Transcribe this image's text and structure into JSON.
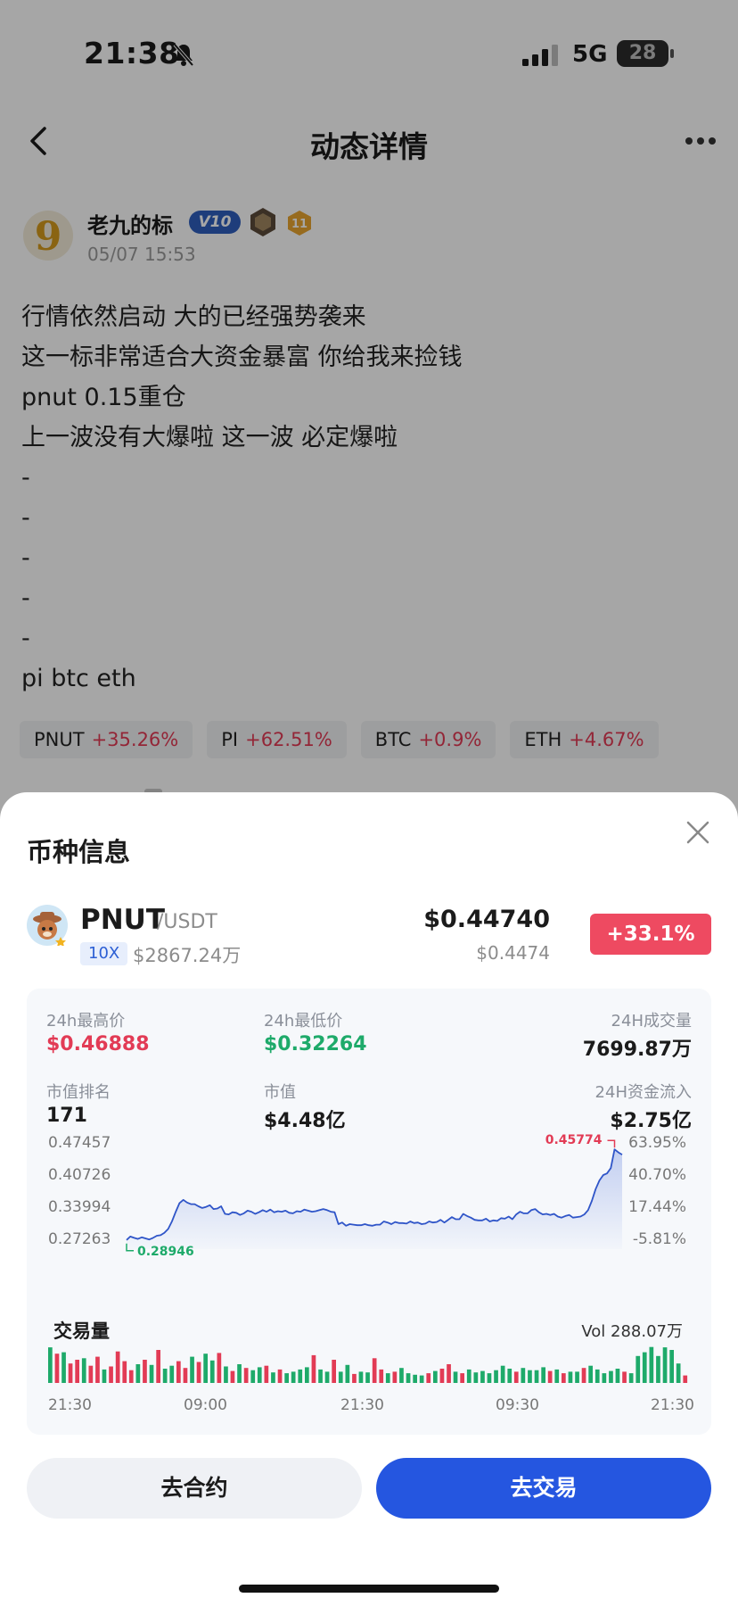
{
  "status_bar": {
    "time": "21:38",
    "network": "5G",
    "battery": "28"
  },
  "header": {
    "title": "动态详情",
    "back_icon": "chevron-left-icon",
    "more_icon": "more-horizontal-icon"
  },
  "post": {
    "author": "老九的标",
    "vip_badge": "V10",
    "level": "11",
    "timestamp": "05/07 15:53",
    "lines": [
      "行情依然启动 大的已经强势袭来",
      "这一标非常适合大资金暴富 你给我来捡钱",
      "pnut 0.15重仓",
      "上一波没有大爆啦 这一波 必定爆啦",
      "-",
      "-",
      "-",
      "-",
      "-",
      "pi btc eth"
    ],
    "tags": [
      {
        "symbol": "PNUT",
        "change": "+35.26%"
      },
      {
        "symbol": "PI",
        "change": "+62.51%"
      },
      {
        "symbol": "BTC",
        "change": "+0.9%"
      },
      {
        "symbol": "ETH",
        "change": "+4.67%"
      }
    ]
  },
  "sheet": {
    "title": "币种信息",
    "coin": {
      "symbol": "PNUT",
      "quote": "/USDT",
      "leverage": "10X",
      "market_cap_short": "$2867.24万",
      "price": "$0.44740",
      "price_sub": "$0.4474",
      "change": "+33.1%"
    },
    "stats": {
      "high_label": "24h最高价",
      "high": "$0.46888",
      "low_label": "24h最低价",
      "low": "$0.32264",
      "vol_label": "24H成交量",
      "vol": "7699.87万",
      "rank_label": "市值排名",
      "rank": "171",
      "mcap_label": "市值",
      "mcap": "$4.48亿",
      "inflow_label": "24H资金流入",
      "inflow": "$2.75亿"
    },
    "volume": {
      "title": "交易量",
      "total": "Vol 288.07万"
    },
    "buttons": {
      "contract": "去合约",
      "trade": "去交易"
    }
  },
  "chart_data": {
    "type": "area",
    "y_ticks": [
      "0.47457",
      "0.40726",
      "0.33994",
      "0.27263"
    ],
    "pct_ticks": [
      "63.95%",
      "40.70%",
      "17.44%",
      "-5.81%"
    ],
    "ylim": [
      0.27263,
      0.47457
    ],
    "x_ticks": [
      "21:30",
      "09:00",
      "21:30",
      "09:30",
      "21:30"
    ],
    "max_label": "0.45774",
    "min_label": "0.28946",
    "price_series": [
      0.2895,
      0.296,
      0.2935,
      0.2915,
      0.2945,
      0.2925,
      0.2905,
      0.2935,
      0.2975,
      0.2985,
      0.303,
      0.31,
      0.324,
      0.342,
      0.358,
      0.364,
      0.359,
      0.356,
      0.356,
      0.352,
      0.349,
      0.351,
      0.354,
      0.347,
      0.348,
      0.352,
      0.338,
      0.337,
      0.341,
      0.34,
      0.336,
      0.339,
      0.344,
      0.342,
      0.338,
      0.341,
      0.345,
      0.342,
      0.346,
      0.341,
      0.343,
      0.342,
      0.344,
      0.34,
      0.339,
      0.343,
      0.342,
      0.346,
      0.344,
      0.342,
      0.343,
      0.345,
      0.347,
      0.345,
      0.342,
      0.341,
      0.319,
      0.322,
      0.316,
      0.319,
      0.318,
      0.317,
      0.317,
      0.319,
      0.317,
      0.316,
      0.318,
      0.318,
      0.324,
      0.322,
      0.319,
      0.323,
      0.321,
      0.321,
      0.32,
      0.324,
      0.321,
      0.322,
      0.319,
      0.32,
      0.324,
      0.322,
      0.323,
      0.327,
      0.322,
      0.327,
      0.332,
      0.328,
      0.328,
      0.338,
      0.334,
      0.331,
      0.327,
      0.326,
      0.326,
      0.329,
      0.324,
      0.326,
      0.325,
      0.33,
      0.329,
      0.333,
      0.328,
      0.337,
      0.342,
      0.339,
      0.339,
      0.345,
      0.347,
      0.341,
      0.337,
      0.338,
      0.336,
      0.338,
      0.333,
      0.331,
      0.334,
      0.336,
      0.331,
      0.332,
      0.333,
      0.337,
      0.345,
      0.362,
      0.384,
      0.4,
      0.41,
      0.413,
      0.423,
      0.4577,
      0.452,
      0.448
    ],
    "volume_series": [
      {
        "v": 0.95,
        "dir": "up"
      },
      {
        "v": 0.78,
        "dir": "down"
      },
      {
        "v": 0.82,
        "dir": "up"
      },
      {
        "v": 0.52,
        "dir": "down"
      },
      {
        "v": 0.62,
        "dir": "down"
      },
      {
        "v": 0.66,
        "dir": "up"
      },
      {
        "v": 0.46,
        "dir": "down"
      },
      {
        "v": 0.7,
        "dir": "down"
      },
      {
        "v": 0.36,
        "dir": "up"
      },
      {
        "v": 0.44,
        "dir": "down"
      },
      {
        "v": 0.84,
        "dir": "down"
      },
      {
        "v": 0.58,
        "dir": "down"
      },
      {
        "v": 0.34,
        "dir": "down"
      },
      {
        "v": 0.5,
        "dir": "up"
      },
      {
        "v": 0.62,
        "dir": "down"
      },
      {
        "v": 0.48,
        "dir": "up"
      },
      {
        "v": 0.88,
        "dir": "down"
      },
      {
        "v": 0.38,
        "dir": "up"
      },
      {
        "v": 0.46,
        "dir": "up"
      },
      {
        "v": 0.58,
        "dir": "down"
      },
      {
        "v": 0.4,
        "dir": "down"
      },
      {
        "v": 0.7,
        "dir": "up"
      },
      {
        "v": 0.56,
        "dir": "down"
      },
      {
        "v": 0.78,
        "dir": "up"
      },
      {
        "v": 0.6,
        "dir": "up"
      },
      {
        "v": 0.8,
        "dir": "down"
      },
      {
        "v": 0.44,
        "dir": "up"
      },
      {
        "v": 0.32,
        "dir": "down"
      },
      {
        "v": 0.5,
        "dir": "up"
      },
      {
        "v": 0.4,
        "dir": "down"
      },
      {
        "v": 0.34,
        "dir": "up"
      },
      {
        "v": 0.42,
        "dir": "up"
      },
      {
        "v": 0.46,
        "dir": "down"
      },
      {
        "v": 0.28,
        "dir": "up"
      },
      {
        "v": 0.36,
        "dir": "down"
      },
      {
        "v": 0.26,
        "dir": "up"
      },
      {
        "v": 0.3,
        "dir": "up"
      },
      {
        "v": 0.36,
        "dir": "up"
      },
      {
        "v": 0.42,
        "dir": "up"
      },
      {
        "v": 0.74,
        "dir": "down"
      },
      {
        "v": 0.36,
        "dir": "up"
      },
      {
        "v": 0.3,
        "dir": "up"
      },
      {
        "v": 0.62,
        "dir": "down"
      },
      {
        "v": 0.3,
        "dir": "up"
      },
      {
        "v": 0.48,
        "dir": "up"
      },
      {
        "v": 0.24,
        "dir": "down"
      },
      {
        "v": 0.3,
        "dir": "up"
      },
      {
        "v": 0.28,
        "dir": "up"
      },
      {
        "v": 0.66,
        "dir": "down"
      },
      {
        "v": 0.36,
        "dir": "down"
      },
      {
        "v": 0.26,
        "dir": "up"
      },
      {
        "v": 0.3,
        "dir": "down"
      },
      {
        "v": 0.4,
        "dir": "up"
      },
      {
        "v": 0.26,
        "dir": "up"
      },
      {
        "v": 0.22,
        "dir": "up"
      },
      {
        "v": 0.2,
        "dir": "up"
      },
      {
        "v": 0.26,
        "dir": "down"
      },
      {
        "v": 0.32,
        "dir": "up"
      },
      {
        "v": 0.38,
        "dir": "down"
      },
      {
        "v": 0.5,
        "dir": "down"
      },
      {
        "v": 0.3,
        "dir": "up"
      },
      {
        "v": 0.26,
        "dir": "down"
      },
      {
        "v": 0.36,
        "dir": "up"
      },
      {
        "v": 0.28,
        "dir": "up"
      },
      {
        "v": 0.32,
        "dir": "up"
      },
      {
        "v": 0.26,
        "dir": "up"
      },
      {
        "v": 0.34,
        "dir": "up"
      },
      {
        "v": 0.46,
        "dir": "up"
      },
      {
        "v": 0.38,
        "dir": "up"
      },
      {
        "v": 0.3,
        "dir": "down"
      },
      {
        "v": 0.4,
        "dir": "up"
      },
      {
        "v": 0.34,
        "dir": "up"
      },
      {
        "v": 0.34,
        "dir": "up"
      },
      {
        "v": 0.42,
        "dir": "up"
      },
      {
        "v": 0.32,
        "dir": "down"
      },
      {
        "v": 0.36,
        "dir": "up"
      },
      {
        "v": 0.26,
        "dir": "down"
      },
      {
        "v": 0.3,
        "dir": "up"
      },
      {
        "v": 0.3,
        "dir": "up"
      },
      {
        "v": 0.4,
        "dir": "down"
      },
      {
        "v": 0.46,
        "dir": "up"
      },
      {
        "v": 0.36,
        "dir": "up"
      },
      {
        "v": 0.26,
        "dir": "up"
      },
      {
        "v": 0.32,
        "dir": "up"
      },
      {
        "v": 0.38,
        "dir": "up"
      },
      {
        "v": 0.3,
        "dir": "down"
      },
      {
        "v": 0.26,
        "dir": "up"
      },
      {
        "v": 0.72,
        "dir": "up"
      },
      {
        "v": 0.82,
        "dir": "up"
      },
      {
        "v": 0.96,
        "dir": "up"
      },
      {
        "v": 0.72,
        "dir": "up"
      },
      {
        "v": 0.95,
        "dir": "up"
      },
      {
        "v": 0.88,
        "dir": "up"
      },
      {
        "v": 0.52,
        "dir": "up"
      },
      {
        "v": 0.2,
        "dir": "down"
      }
    ],
    "colors": {
      "line": "#2f55c8",
      "up": "#1eaa6a",
      "down": "#e23b55",
      "max": "#e23b55",
      "min": "#1eaa6a"
    }
  }
}
